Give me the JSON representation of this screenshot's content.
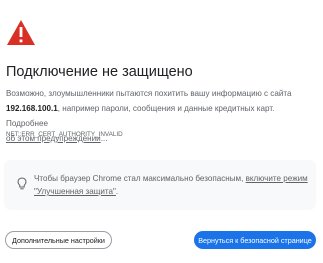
{
  "colors": {
    "warning_red": "#d93025",
    "primary_blue": "#1a73e8",
    "text_dark": "#202124",
    "text_grey": "#5f6368",
    "tip_background": "#f8f9fa"
  },
  "icons": {
    "warning": "warning-triangle-icon",
    "tip": "lightbulb-icon"
  },
  "interstitial": {
    "title": "Подключение не защищено",
    "description": {
      "line1": "Возможно, злоумышленники пытаются похитить вашу информацию с сайта",
      "ip": "192.168.100.1",
      "line2_tail": ", например пароли, сообщения и данные кредитных карт. Подробнее",
      "link": "об этом предупреждении",
      "ellipsis": "..."
    },
    "error_code": "NET::ERR_CERT_AUTHORITY_INVALID",
    "tip": {
      "text": "Чтобы браузер Chrome стал максимально безопасным, ",
      "link": "включите режим \"Улучшенная защита\"",
      "suffix": "."
    },
    "buttons": {
      "advanced": "Дополнительные настройки",
      "back_to_safety": "Вернуться к безопасной странице"
    }
  }
}
